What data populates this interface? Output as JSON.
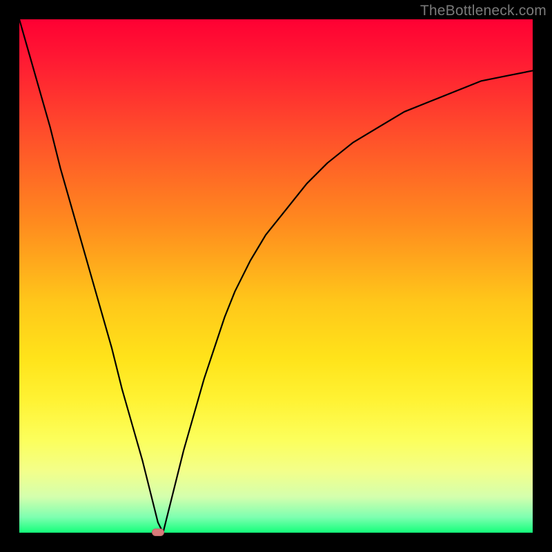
{
  "watermark": {
    "text": "TheBottleneck.com"
  },
  "colors": {
    "curve": "#000000",
    "marker": "#d97a7a",
    "frame": "#000000"
  },
  "chart_data": {
    "type": "line",
    "title": "",
    "xlabel": "",
    "ylabel": "",
    "xlim": [
      0,
      100
    ],
    "ylim": [
      0,
      100
    ],
    "grid": false,
    "legend": false,
    "annotations": [],
    "series": [
      {
        "name": "bottleneck-curve",
        "x": [
          0,
          2,
          4,
          6,
          8,
          10,
          12,
          14,
          16,
          18,
          20,
          22,
          24,
          26,
          27,
          28,
          30,
          32,
          34,
          36,
          38,
          40,
          42,
          45,
          48,
          52,
          56,
          60,
          65,
          70,
          75,
          80,
          85,
          90,
          95,
          100
        ],
        "values": [
          100,
          93,
          86,
          79,
          71,
          64,
          57,
          50,
          43,
          36,
          28,
          21,
          14,
          6,
          2,
          0,
          8,
          16,
          23,
          30,
          36,
          42,
          47,
          53,
          58,
          63,
          68,
          72,
          76,
          79,
          82,
          84,
          86,
          88,
          89,
          90
        ]
      }
    ],
    "marker": {
      "x": 27,
      "y": 0
    }
  }
}
